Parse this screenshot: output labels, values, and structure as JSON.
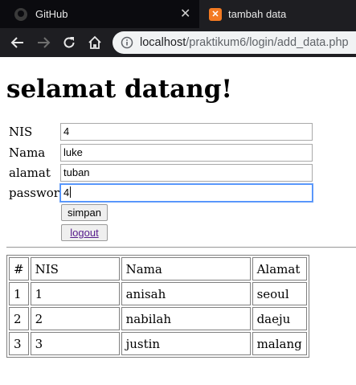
{
  "browser": {
    "tabs": [
      {
        "title": "GitHub"
      },
      {
        "title": "tambah data",
        "active": true
      }
    ],
    "url": {
      "host": "localhost",
      "path": "/praktikum6/login/add_data.php"
    }
  },
  "page": {
    "heading": "selamat datang!",
    "form": {
      "nis": {
        "label": "NIS",
        "value": "4"
      },
      "nama": {
        "label": "Nama",
        "value": "luke"
      },
      "alamat": {
        "label": "alamat",
        "value": "tuban"
      },
      "password": {
        "label": "password",
        "value": "4"
      },
      "submit_label": "simpan",
      "logout_label": "logout"
    },
    "table": {
      "headers": [
        "#",
        "NIS",
        "Nama",
        "Alamat"
      ],
      "rows": [
        [
          "1",
          "1",
          "anisah",
          "seoul"
        ],
        [
          "2",
          "2",
          "nabilah",
          "daeju"
        ],
        [
          "3",
          "3",
          "justin",
          "malang"
        ]
      ]
    }
  }
}
